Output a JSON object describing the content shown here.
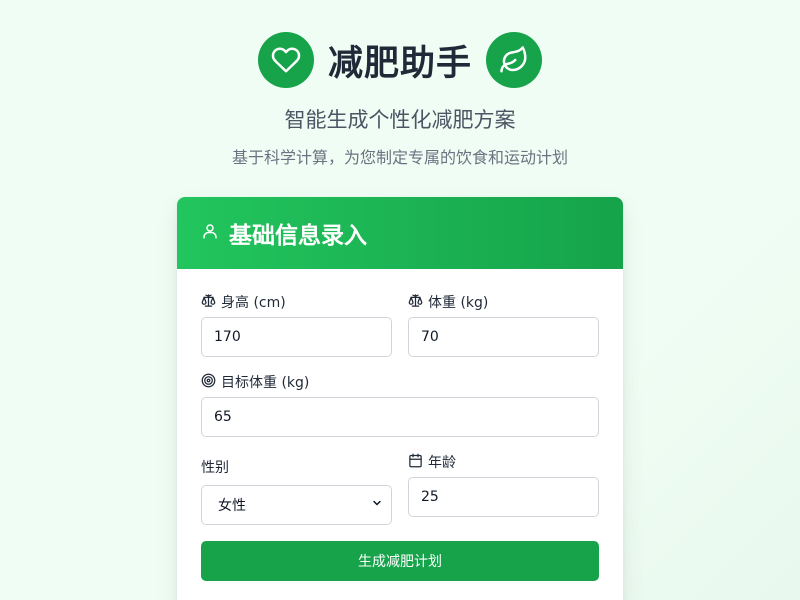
{
  "app": {
    "title": "减肥助手",
    "subtitle": "智能生成个性化减肥方案",
    "description": "基于科学计算，为您制定专属的饮食和运动计划"
  },
  "form": {
    "title": "基础信息录入",
    "height": {
      "label": "身高 (cm)",
      "value": "170",
      "icon": "scale-icon"
    },
    "weight": {
      "label": "体重 (kg)",
      "value": "70",
      "icon": "scale-icon"
    },
    "target_weight": {
      "label": "目标体重 (kg)",
      "value": "65",
      "icon": "target-icon"
    },
    "gender": {
      "label": "性别",
      "value": "女性"
    },
    "age": {
      "label": "年龄",
      "value": "25",
      "icon": "calendar-icon"
    },
    "submit_label": "生成减肥计划"
  },
  "colors": {
    "primary": "#16a34a",
    "primary_light": "#22c55e",
    "background": "#f0fdf4"
  }
}
